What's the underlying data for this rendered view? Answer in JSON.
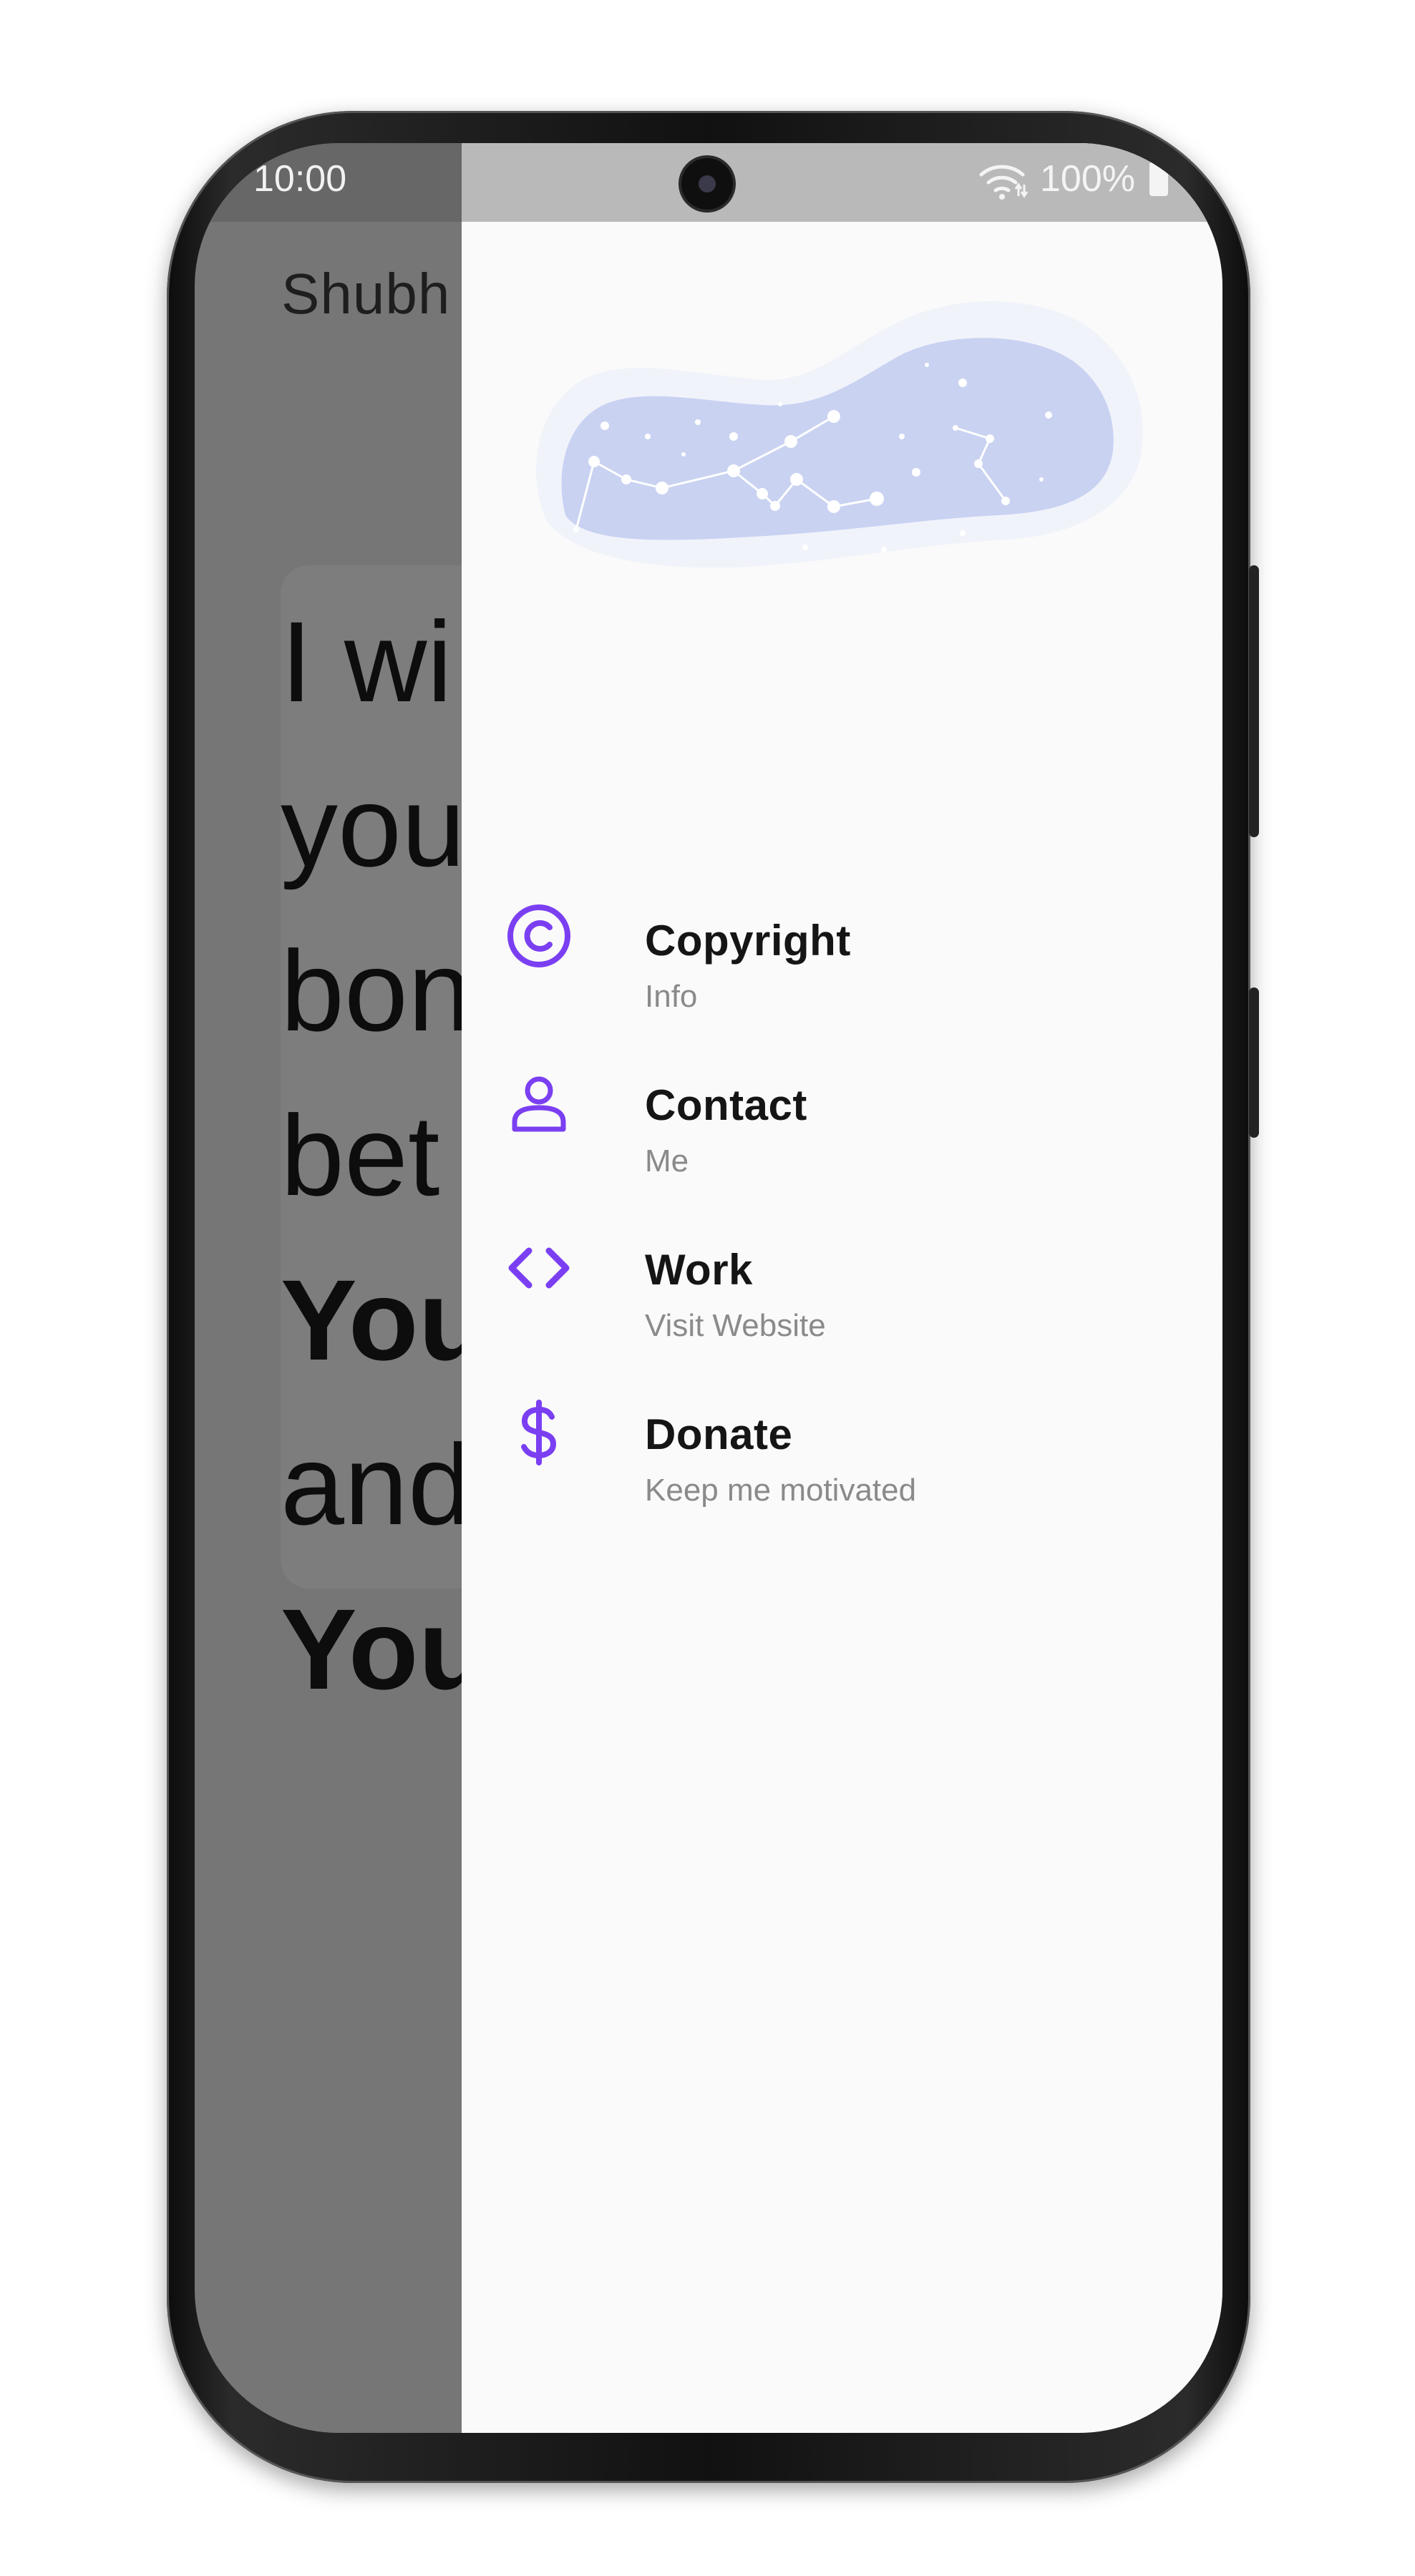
{
  "status_bar": {
    "time": "10:00",
    "battery": "100%"
  },
  "background": {
    "app_title": "Shubh",
    "quote_lines": [
      {
        "text": "I wi",
        "bold": false
      },
      {
        "text": "you",
        "bold": false
      },
      {
        "text": "bon",
        "bold": false
      },
      {
        "text": "bet",
        "bold": false
      },
      {
        "text": "You",
        "bold": true
      },
      {
        "text": "and",
        "bold": false
      },
      {
        "text": "You",
        "bold": true
      }
    ]
  },
  "drawer": {
    "menu": [
      {
        "icon": "copyright-icon",
        "title": "Copyright",
        "subtitle": "Info"
      },
      {
        "icon": "person-icon",
        "title": "Contact",
        "subtitle": "Me"
      },
      {
        "icon": "code-icon",
        "title": "Work",
        "subtitle": "Visit Website"
      },
      {
        "icon": "dollar-icon",
        "title": "Donate",
        "subtitle": "Keep me motivated"
      }
    ]
  },
  "colors": {
    "accent": "#7b3ff2",
    "illustration_blob": "#c9d2f1",
    "scrim": "#767676",
    "drawer_bg": "#fafafa"
  }
}
